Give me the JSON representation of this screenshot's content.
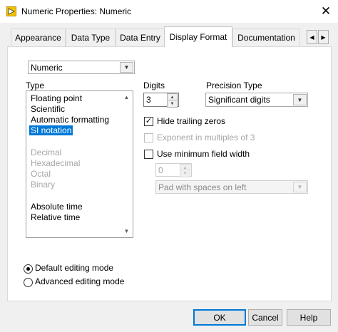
{
  "window": {
    "title": "Numeric Properties: Numeric",
    "close_glyph": "✕"
  },
  "tabs": [
    {
      "label": "Appearance",
      "active": false
    },
    {
      "label": "Data Type",
      "active": false
    },
    {
      "label": "Data Entry",
      "active": false
    },
    {
      "label": "Display Format",
      "active": true
    },
    {
      "label": "Documentation",
      "active": false
    }
  ],
  "tab_scroll": {
    "left": "◀",
    "right": "▶"
  },
  "format_select": {
    "value": "Numeric"
  },
  "type_section": {
    "label": "Type",
    "groups": [
      {
        "items": [
          {
            "label": "Floating point",
            "state": "normal"
          },
          {
            "label": "Scientific",
            "state": "normal"
          },
          {
            "label": "Automatic formatting",
            "state": "normal"
          },
          {
            "label": "SI notation",
            "state": "selected"
          }
        ]
      },
      {
        "items": [
          {
            "label": "Decimal",
            "state": "disabled"
          },
          {
            "label": "Hexadecimal",
            "state": "disabled"
          },
          {
            "label": "Octal",
            "state": "disabled"
          },
          {
            "label": "Binary",
            "state": "disabled"
          }
        ]
      },
      {
        "items": [
          {
            "label": "Absolute time",
            "state": "normal"
          },
          {
            "label": "Relative time",
            "state": "normal"
          }
        ]
      }
    ]
  },
  "digits": {
    "label": "Digits",
    "value": "3"
  },
  "precision_type": {
    "label": "Precision Type",
    "value": "Significant digits"
  },
  "options": {
    "hide_trailing_zeros": {
      "label": "Hide trailing zeros",
      "checked": true,
      "enabled": true
    },
    "exponent_multiples": {
      "label": "Exponent in multiples of 3",
      "checked": false,
      "enabled": false
    },
    "min_field_width": {
      "label": "Use minimum field width",
      "checked": false,
      "enabled": true
    }
  },
  "field_width": {
    "value": "0"
  },
  "pad_select": {
    "value": "Pad with spaces on left"
  },
  "editing_mode": {
    "default": {
      "label": "Default editing mode",
      "selected": true
    },
    "advanced": {
      "label": "Advanced editing mode",
      "selected": false
    }
  },
  "buttons": {
    "ok": "OK",
    "cancel": "Cancel",
    "help": "Help"
  },
  "colors": {
    "selection": "#0078d7",
    "app_icon": "#f2c200"
  }
}
